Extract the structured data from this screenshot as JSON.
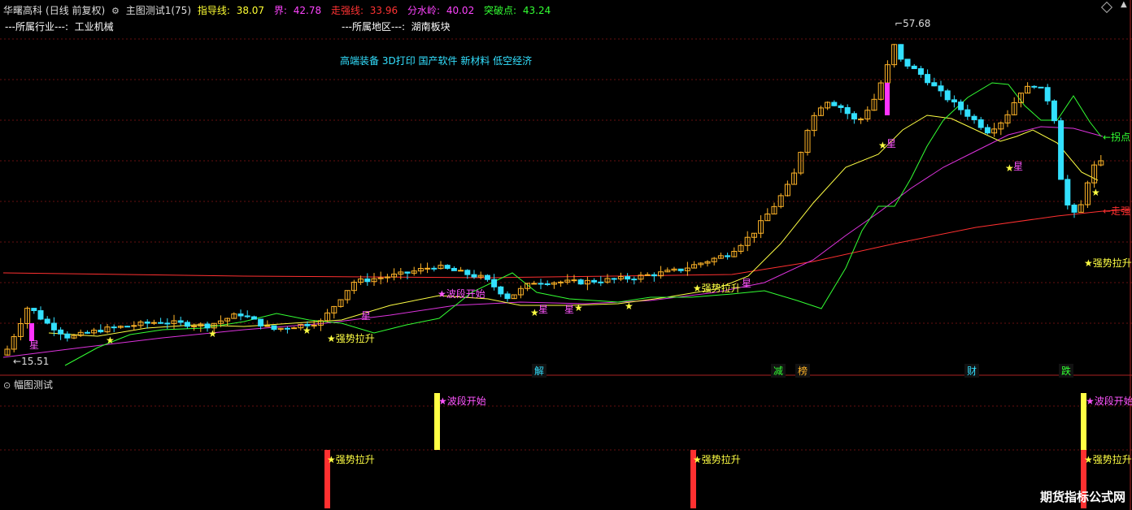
{
  "header": {
    "stock_name": "华曙高科",
    "mode": "(日线 前复权)",
    "gear_icon": "gear-icon",
    "indicator_name": "主图测试1(75)",
    "items": [
      {
        "label": "指导线: ",
        "value": "38.07",
        "color": "#ffff33"
      },
      {
        "label": "界: ",
        "value": "42.78",
        "color": "#ff44ff"
      },
      {
        "label": "走强线: ",
        "value": "33.96",
        "color": "#ff3333"
      },
      {
        "label": "分水岭: ",
        "value": "40.02",
        "color": "#ff44ff"
      },
      {
        "label": "突破点: ",
        "value": "43.24",
        "color": "#33ff33"
      }
    ]
  },
  "info": {
    "industry_label": "---所属行业---:",
    "industry_value": "工业机械",
    "region_label": "---所属地区---:",
    "region_value": "湖南板块",
    "concepts": "高端装备 3D打印 国产软件 新材料 低空经济"
  },
  "price_marks": {
    "high": "57.68",
    "low": "15.51"
  },
  "right_labels": {
    "turn": "←拐点",
    "strong": "←走强"
  },
  "signals": {
    "strong_rise": "★强势拉升",
    "wave_start": "★波段开始",
    "star_char": "★",
    "xing": "星"
  },
  "events": [
    "解",
    "减",
    "榜",
    "财",
    "跌"
  ],
  "sub_panel": {
    "title": "幅图测试",
    "toggle_icon": "collapse-icon"
  },
  "watermark": "期货指标公式网",
  "colors": {
    "up": "#ffb428",
    "down": "#33e0ff",
    "magenta": "#ff33ff",
    "guide": "#ffff44",
    "strong": "#ff3030",
    "boundary": "#dd33dd",
    "breakout": "#33ff33"
  }
}
